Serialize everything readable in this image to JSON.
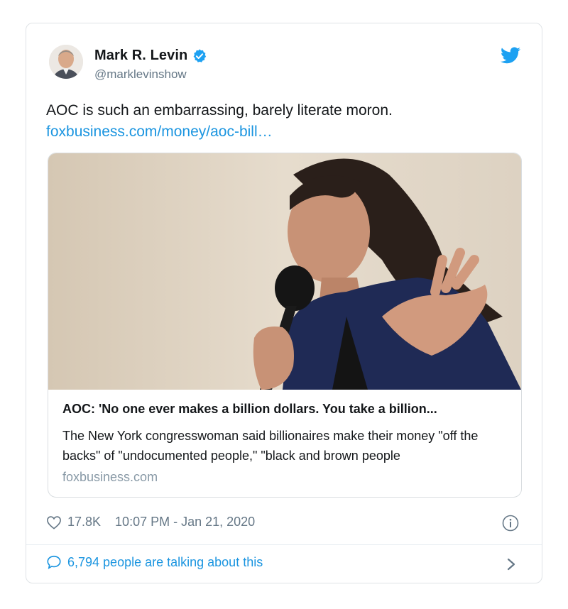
{
  "tweet": {
    "author_name": "Mark R. Levin",
    "author_handle": "@marklevinshow",
    "text": "AOC is such an embarrassing, barely literate moron.",
    "link_text": "foxbusiness.com/money/aoc-bill…",
    "likes": "17.8K",
    "timestamp": "10:07 PM - Jan 21, 2020",
    "talking": "6,794 people are talking about this"
  },
  "link_card": {
    "title": "AOC: 'No one ever makes a billion dollars. You take a billion...",
    "description": "The New York congresswoman said billionaires make their money \"off the backs\" of \"undocumented people,\" \"black and brown people",
    "domain": "foxbusiness.com"
  },
  "icons": {
    "verified": "verified-badge-icon",
    "bird": "twitter-bird-icon",
    "heart": "heart-icon",
    "info": "info-icon",
    "reply": "speech-bubble-icon",
    "chevron": "chevron-right-icon"
  },
  "colors": {
    "accent": "#1b95e0",
    "muted": "#657786",
    "text": "#14171a"
  }
}
